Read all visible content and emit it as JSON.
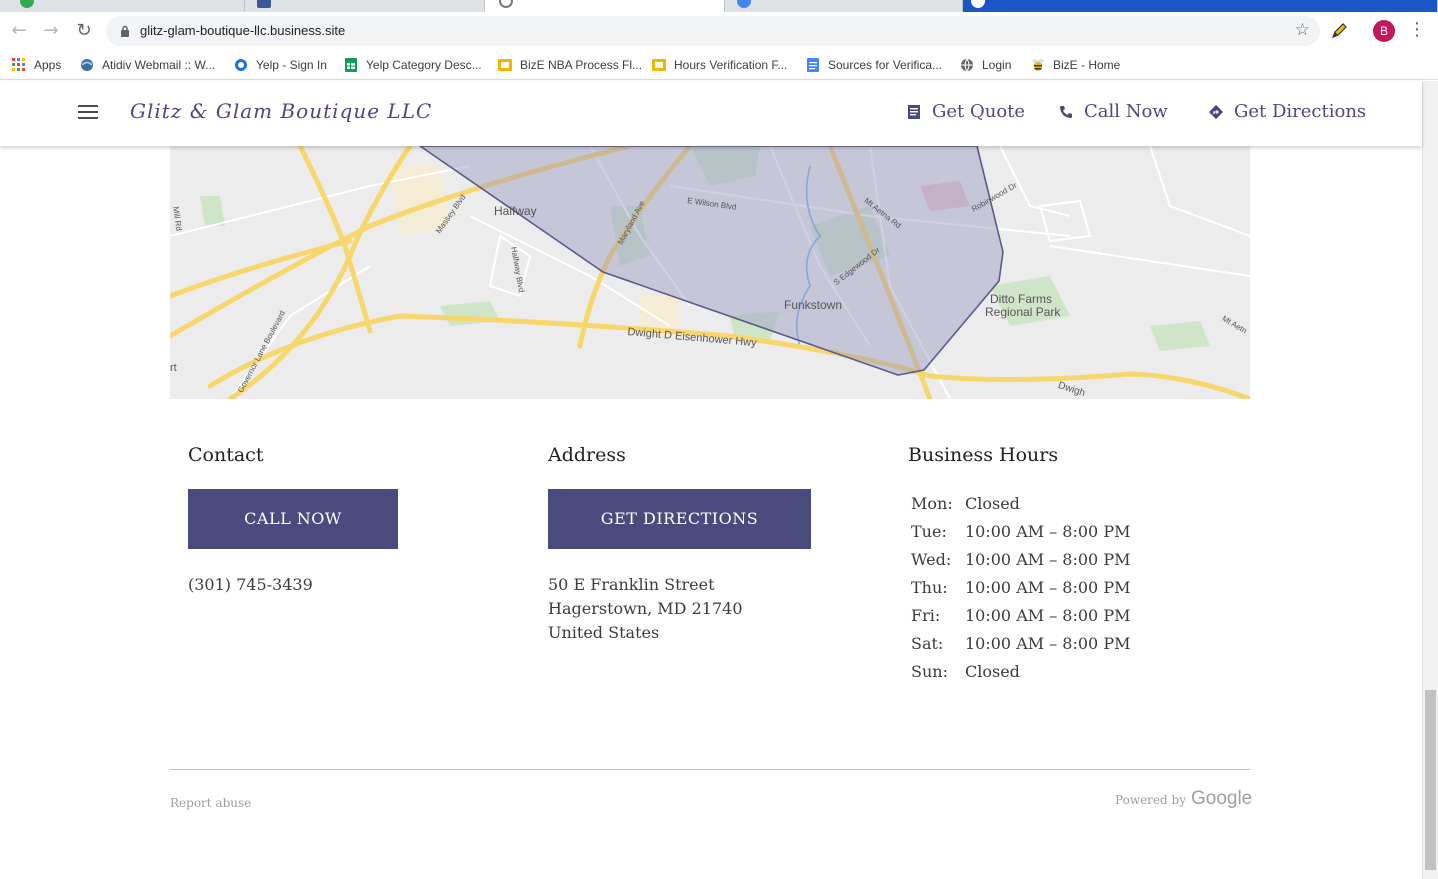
{
  "browser": {
    "url": "glitz-glam-boutique-llc.business.site",
    "profile_initial": "B",
    "bookmarks": [
      {
        "label": "Apps",
        "icon": "apps-grid-icon"
      },
      {
        "label": "Atidiv Webmail :: W...",
        "icon": "webmail-icon"
      },
      {
        "label": "Yelp - Sign In",
        "icon": "yelp-icon"
      },
      {
        "label": "Yelp Category Desc...",
        "icon": "sheets-icon"
      },
      {
        "label": "BizE NBA Process Fl...",
        "icon": "slides-icon"
      },
      {
        "label": "Hours Verification F...",
        "icon": "slides-icon"
      },
      {
        "label": "Sources for Verifica...",
        "icon": "docs-icon"
      },
      {
        "label": "Login",
        "icon": "globe-icon"
      },
      {
        "label": "BizE - Home",
        "icon": "bee-icon"
      }
    ]
  },
  "header": {
    "logo": "Glitz & Glam Boutique LLC",
    "nav": [
      {
        "label": "Get Quote",
        "icon": "quote-icon"
      },
      {
        "label": "Call Now",
        "icon": "phone-icon"
      },
      {
        "label": "Get Directions",
        "icon": "directions-icon"
      }
    ]
  },
  "map": {
    "labels": [
      "Halfway",
      "Funkstown",
      "Ditto Farms",
      "Regional Park",
      "Dwight D Eisenhower Hwy",
      "E Wilson Blvd",
      "Mt Aetna Rd",
      "Robinwood Dr",
      "S Edgewood Dr",
      "Maryland Ave",
      "Massey Blvd",
      "Halfway Blvd",
      "Governor Lane Boulevard",
      "Mill Rd",
      "Dwigh",
      "rt",
      "Mt Aetn"
    ]
  },
  "contact": {
    "title": "Contact",
    "button": "CALL NOW",
    "phone": "(301) 745-3439"
  },
  "address": {
    "title": "Address",
    "button": "GET DIRECTIONS",
    "line1": "50 E Franklin Street",
    "line2": "Hagerstown, MD 21740",
    "line3": "United States"
  },
  "hours": {
    "title": "Business Hours",
    "rows": [
      {
        "day": "Mon:",
        "time": "Closed"
      },
      {
        "day": "Tue:",
        "time": "10:00 AM – 8:00 PM"
      },
      {
        "day": "Wed:",
        "time": "10:00 AM – 8:00 PM"
      },
      {
        "day": "Thu:",
        "time": "10:00 AM – 8:00 PM"
      },
      {
        "day": "Fri:",
        "time": "10:00 AM – 8:00 PM"
      },
      {
        "day": "Sat:",
        "time": "10:00 AM – 8:00 PM"
      },
      {
        "day": "Sun:",
        "time": "Closed"
      }
    ]
  },
  "footer": {
    "report": "Report abuse",
    "powered": "Powered by",
    "google": "Google"
  },
  "colors": {
    "brand": "#4a4a7e",
    "map_area": "#9a9ac4",
    "road": "#f7d66b"
  }
}
